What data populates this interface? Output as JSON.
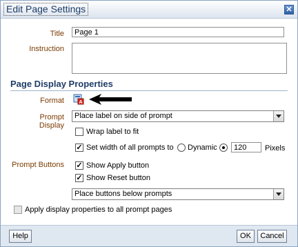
{
  "dialog": {
    "title": "Edit Page Settings",
    "close_icon": "close-icon"
  },
  "fields": {
    "title_label": "Title",
    "title_value": "Page 1",
    "instruction_label": "Instruction",
    "instruction_value": ""
  },
  "section": {
    "title": "Page Display Properties"
  },
  "format": {
    "label": "Format",
    "icon": "format-edit-icon",
    "annotation": "arrow-pointer-icon"
  },
  "prompt_display": {
    "label": "Prompt Display",
    "selected": "Place label on side of prompt",
    "wrap_label": "Wrap label to fit",
    "wrap_checked": false,
    "set_width_label": "Set width of all prompts to",
    "set_width_checked": true,
    "dynamic_label": "Dynamic",
    "dynamic_selected": false,
    "width_value": "120",
    "pixels_label": "Pixels"
  },
  "prompt_buttons": {
    "label": "Prompt Buttons",
    "show_apply_label": "Show Apply button",
    "show_apply_checked": true,
    "show_reset_label": "Show Reset button",
    "show_reset_checked": true,
    "placement_selected": "Place buttons below prompts"
  },
  "apply_all": {
    "label": "Apply display properties to all prompt pages",
    "checked": false
  },
  "footer": {
    "help": "Help",
    "ok": "OK",
    "cancel": "Cancel"
  },
  "colors": {
    "label_color": "#7a3a00",
    "title_color": "#1f3c66",
    "footer_bg": "#dfe7f1"
  }
}
